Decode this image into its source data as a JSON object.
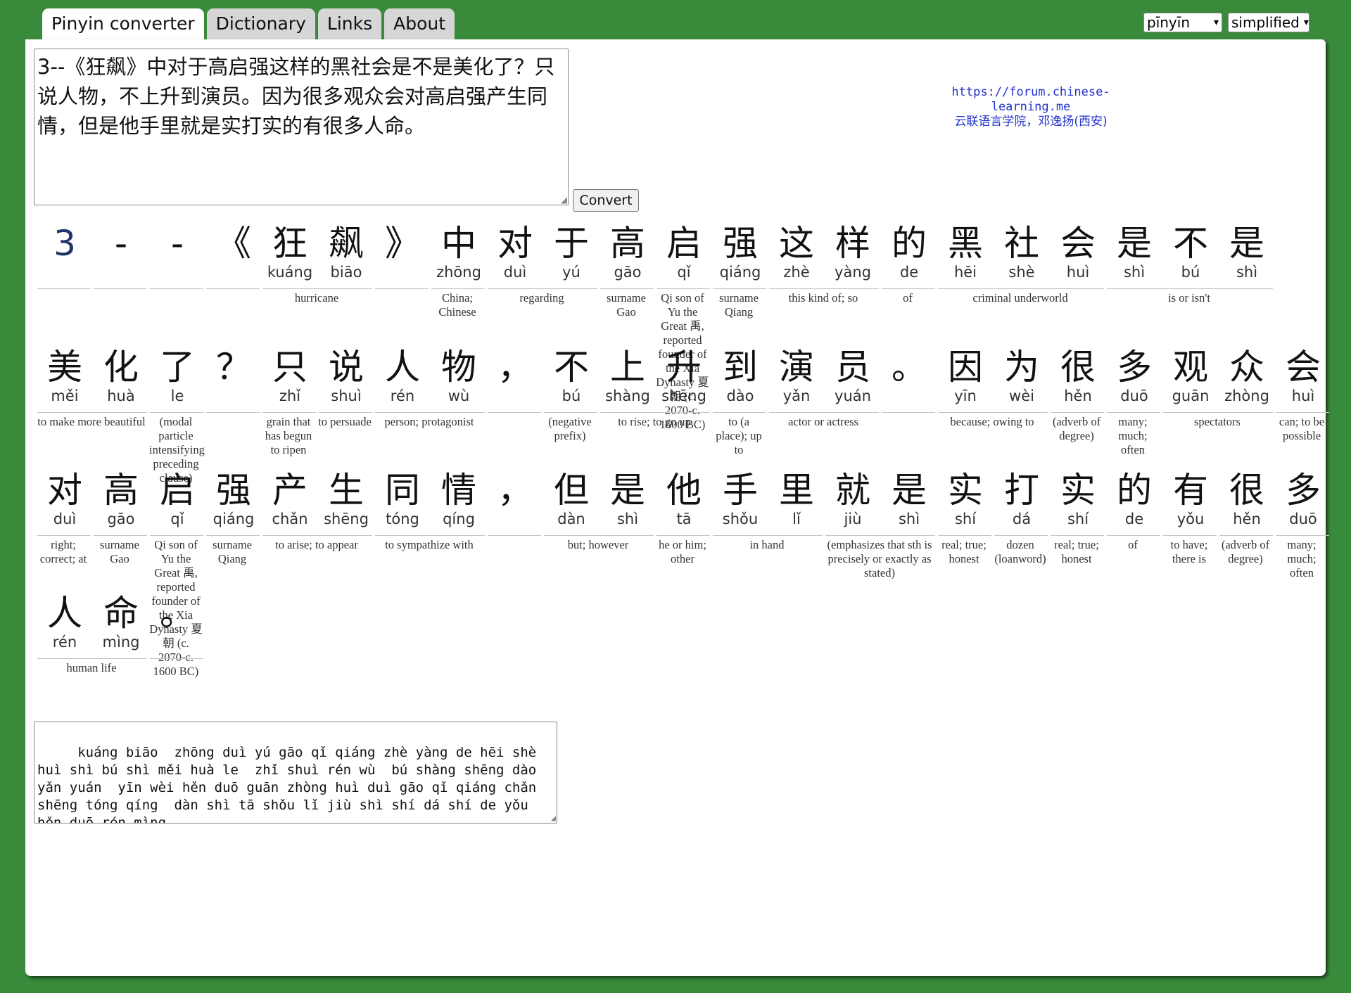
{
  "tabs": [
    "Pinyin converter",
    "Dictionary",
    "Links",
    "About"
  ],
  "selects": {
    "romanization": "pīnyīn",
    "script": "simplified"
  },
  "input": {
    "text": "3--《狂飙》中对于高启强这样的黑社会是不是美化了？只说人物，不上升到演员。因为很多观众会对高启强产生同情，但是他手里就是实打实的有很多人命。"
  },
  "convert_label": "Convert",
  "credit": {
    "url": "https://forum.chinese-learning.me",
    "name": "云联语言学院，邓逸扬(西安)"
  },
  "rows": [
    {
      "words": [
        {
          "zi": [
            "3"
          ],
          "py": [
            ""
          ],
          "gloss": ""
        },
        {
          "zi": [
            "-"
          ],
          "py": [
            ""
          ],
          "gloss": ""
        },
        {
          "zi": [
            "-"
          ],
          "py": [
            ""
          ],
          "gloss": ""
        },
        {
          "zi": [
            "《"
          ],
          "py": [
            ""
          ],
          "gloss": ""
        },
        {
          "zi": [
            "狂",
            "飙"
          ],
          "py": [
            "kuáng",
            "biāo"
          ],
          "gloss": "hurricane"
        },
        {
          "zi": [
            "》"
          ],
          "py": [
            ""
          ],
          "gloss": ""
        },
        {
          "zi": [
            "中"
          ],
          "py": [
            "zhōng"
          ],
          "gloss": "China; Chinese"
        },
        {
          "zi": [
            "对",
            "于"
          ],
          "py": [
            "duì",
            "yú"
          ],
          "gloss": "regarding"
        },
        {
          "zi": [
            "高"
          ],
          "py": [
            "gāo"
          ],
          "gloss": "surname Gao"
        },
        {
          "zi": [
            "启"
          ],
          "py": [
            "qǐ"
          ],
          "gloss": "Qi son of Yu the Great 禹, reported founder of the Xia Dynasty 夏朝 (c. 2070-c. 1600 BC)"
        },
        {
          "zi": [
            "强"
          ],
          "py": [
            "qiáng"
          ],
          "gloss": "surname Qiang"
        },
        {
          "zi": [
            "这",
            "样"
          ],
          "py": [
            "zhè",
            "yàng"
          ],
          "gloss": "this kind of; so"
        },
        {
          "zi": [
            "的"
          ],
          "py": [
            "de"
          ],
          "gloss": "of"
        },
        {
          "zi": [
            "黑",
            "社",
            "会"
          ],
          "py": [
            "hēi",
            "shè",
            "huì"
          ],
          "gloss": "criminal underworld"
        },
        {
          "zi": [
            "是",
            "不",
            "是"
          ],
          "py": [
            "shì",
            "bú",
            "shì"
          ],
          "gloss": "is or isn't"
        }
      ]
    },
    {
      "words": [
        {
          "zi": [
            "美",
            "化"
          ],
          "py": [
            "měi",
            "huà"
          ],
          "gloss": "to make more beautiful"
        },
        {
          "zi": [
            "了"
          ],
          "py": [
            "le"
          ],
          "gloss": "(modal particle intensifying preceding clause)"
        },
        {
          "zi": [
            "？"
          ],
          "py": [
            ""
          ],
          "gloss": ""
        },
        {
          "zi": [
            "只"
          ],
          "py": [
            "zhǐ"
          ],
          "gloss": "grain that has begun to ripen"
        },
        {
          "zi": [
            "说"
          ],
          "py": [
            "shuì"
          ],
          "gloss": "to persuade"
        },
        {
          "zi": [
            "人",
            "物"
          ],
          "py": [
            "rén",
            "wù"
          ],
          "gloss": "person; protagonist"
        },
        {
          "zi": [
            "，"
          ],
          "py": [
            ""
          ],
          "gloss": ""
        },
        {
          "zi": [
            "不"
          ],
          "py": [
            "bú"
          ],
          "gloss": "(negative prefix)"
        },
        {
          "zi": [
            "上",
            "升"
          ],
          "py": [
            "shàng",
            "shēng"
          ],
          "gloss": "to rise; to go up"
        },
        {
          "zi": [
            "到"
          ],
          "py": [
            "dào"
          ],
          "gloss": "to (a place); up to"
        },
        {
          "zi": [
            "演",
            "员"
          ],
          "py": [
            "yǎn",
            "yuán"
          ],
          "gloss": "actor or actress"
        },
        {
          "zi": [
            "。"
          ],
          "py": [
            ""
          ],
          "gloss": ""
        },
        {
          "zi": [
            "因",
            "为"
          ],
          "py": [
            "yīn",
            "wèi"
          ],
          "gloss": "because; owing to"
        },
        {
          "zi": [
            "很"
          ],
          "py": [
            "hěn"
          ],
          "gloss": "(adverb of degree)"
        },
        {
          "zi": [
            "多"
          ],
          "py": [
            "duō"
          ],
          "gloss": "many; much; often"
        },
        {
          "zi": [
            "观",
            "众"
          ],
          "py": [
            "guān",
            "zhòng"
          ],
          "gloss": "spectators"
        },
        {
          "zi": [
            "会"
          ],
          "py": [
            "huì"
          ],
          "gloss": "can; to be possible"
        }
      ]
    },
    {
      "words": [
        {
          "zi": [
            "对"
          ],
          "py": [
            "duì"
          ],
          "gloss": "right; correct; at"
        },
        {
          "zi": [
            "高"
          ],
          "py": [
            "gāo"
          ],
          "gloss": "surname Gao"
        },
        {
          "zi": [
            "启"
          ],
          "py": [
            "qǐ"
          ],
          "gloss": "Qi son of Yu the Great 禹, reported founder of the Xia Dynasty 夏朝 (c. 2070-c. 1600 BC)"
        },
        {
          "zi": [
            "强"
          ],
          "py": [
            "qiáng"
          ],
          "gloss": "surname Qiang"
        },
        {
          "zi": [
            "产",
            "生"
          ],
          "py": [
            "chǎn",
            "shēng"
          ],
          "gloss": "to arise; to appear"
        },
        {
          "zi": [
            "同",
            "情"
          ],
          "py": [
            "tóng",
            "qíng"
          ],
          "gloss": "to sympathize with"
        },
        {
          "zi": [
            "，"
          ],
          "py": [
            ""
          ],
          "gloss": ""
        },
        {
          "zi": [
            "但",
            "是"
          ],
          "py": [
            "dàn",
            "shì"
          ],
          "gloss": "but; however"
        },
        {
          "zi": [
            "他"
          ],
          "py": [
            "tā"
          ],
          "gloss": "he or him; other"
        },
        {
          "zi": [
            "手",
            "里"
          ],
          "py": [
            "shǒu",
            "lǐ"
          ],
          "gloss": "in hand"
        },
        {
          "zi": [
            "就",
            "是"
          ],
          "py": [
            "jiù",
            "shì"
          ],
          "gloss": "(emphasizes that sth is precisely or exactly as stated)"
        },
        {
          "zi": [
            "实"
          ],
          "py": [
            "shí"
          ],
          "gloss": "real; true; honest"
        },
        {
          "zi": [
            "打"
          ],
          "py": [
            "dá"
          ],
          "gloss": "dozen (loanword)"
        },
        {
          "zi": [
            "实"
          ],
          "py": [
            "shí"
          ],
          "gloss": "real; true; honest"
        },
        {
          "zi": [
            "的"
          ],
          "py": [
            "de"
          ],
          "gloss": "of"
        },
        {
          "zi": [
            "有"
          ],
          "py": [
            "yǒu"
          ],
          "gloss": "to have; there is"
        },
        {
          "zi": [
            "很"
          ],
          "py": [
            "hěn"
          ],
          "gloss": "(adverb of degree)"
        },
        {
          "zi": [
            "多"
          ],
          "py": [
            "duō"
          ],
          "gloss": "many; much; often"
        }
      ]
    },
    {
      "words": [
        {
          "zi": [
            "人",
            "命"
          ],
          "py": [
            "rén",
            "mìng"
          ],
          "gloss": "human life"
        },
        {
          "zi": [
            "。"
          ],
          "py": [
            ""
          ],
          "gloss": ""
        }
      ]
    }
  ],
  "output": "   kuáng biāo  zhōng duì yú gāo qǐ qiáng zhè yàng de hēi shè huì shì bú shì měi huà le  zhǐ shuì rén wù  bú shàng shēng dào yǎn yuán  yīn wèi hěn duō guān zhòng huì duì gāo qǐ qiáng chǎn shēng tóng qíng  dàn shì tā shǒu lǐ jiù shì shí dá shí de yǒu hěn duō rén mìng"
}
